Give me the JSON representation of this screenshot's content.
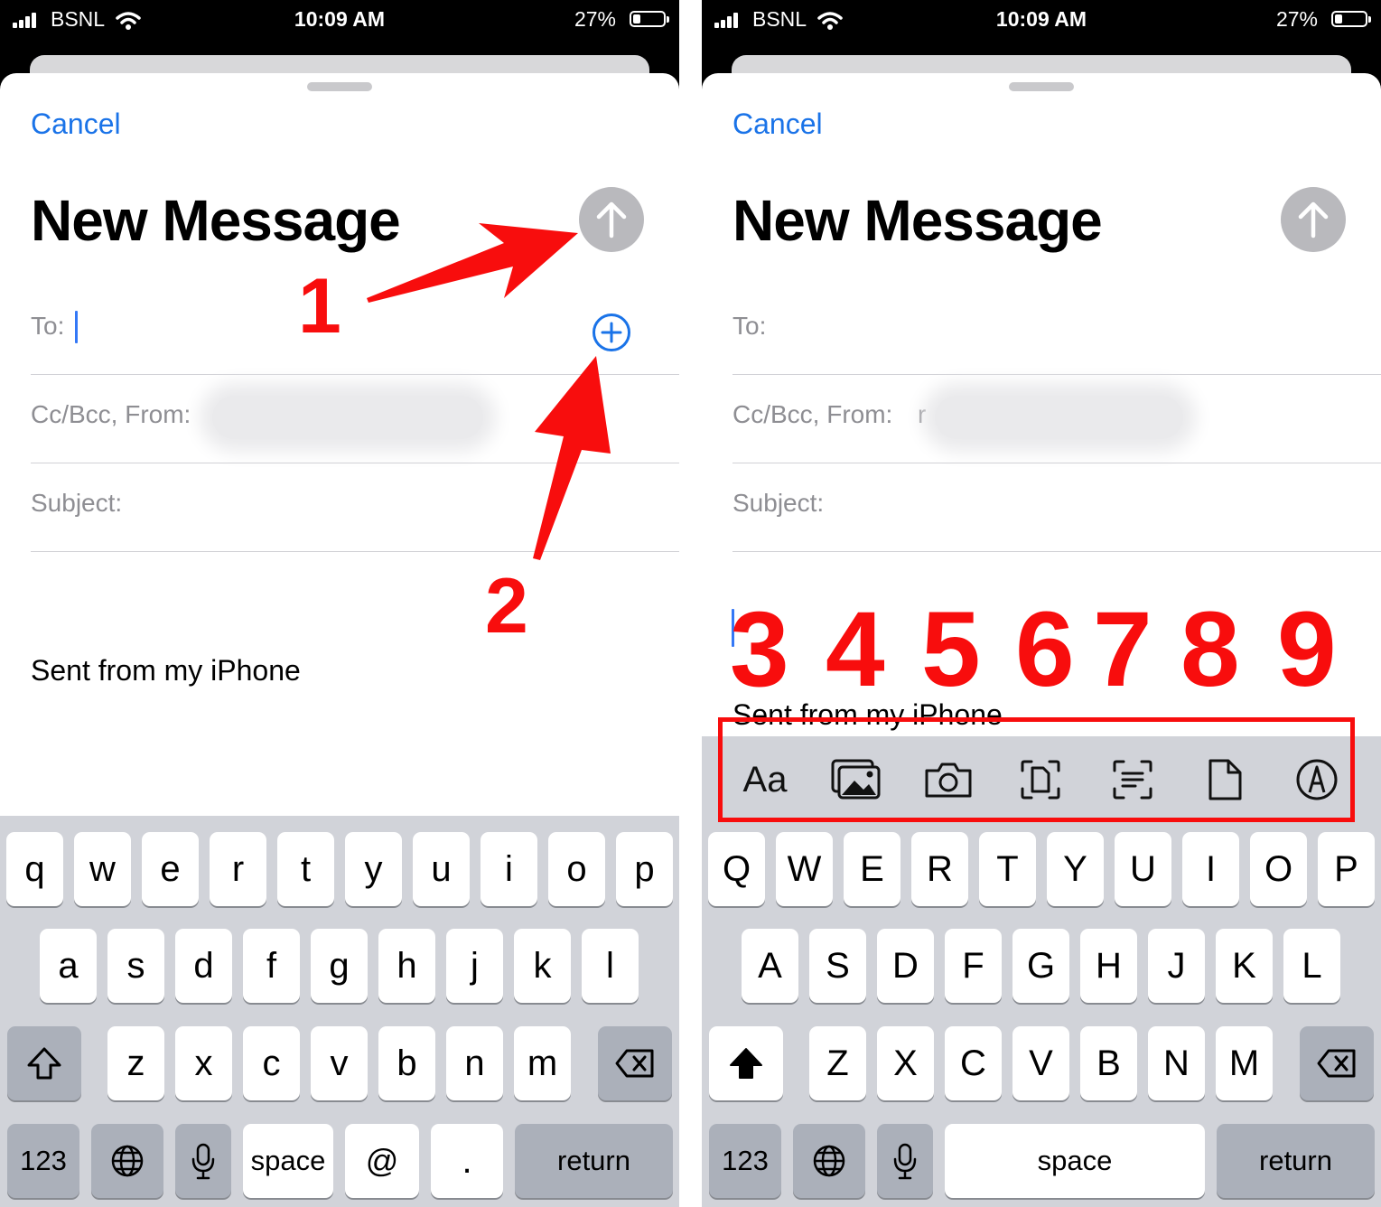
{
  "left_screen": {
    "status_bar": {
      "carrier": "BSNL",
      "time": "10:09 AM",
      "battery_percent": "27%"
    },
    "compose": {
      "cancel_label": "Cancel",
      "title": "New Message",
      "to_label": "To:",
      "cc_from_label": "Cc/Bcc, From:",
      "subject_label": "Subject:",
      "signature": "Sent from my iPhone"
    },
    "keyboard": {
      "row1": [
        "q",
        "w",
        "e",
        "r",
        "t",
        "y",
        "u",
        "i",
        "o",
        "p"
      ],
      "row2": [
        "a",
        "s",
        "d",
        "f",
        "g",
        "h",
        "j",
        "k",
        "l"
      ],
      "row3": [
        "z",
        "x",
        "c",
        "v",
        "b",
        "n",
        "m"
      ],
      "numbers_label": "123",
      "space_label": "space",
      "at_label": "@",
      "period_label": ".",
      "return_label": "return"
    }
  },
  "right_screen": {
    "status_bar": {
      "carrier": "BSNL",
      "time": "10:09 AM",
      "battery_percent": "27%"
    },
    "compose": {
      "cancel_label": "Cancel",
      "title": "New Message",
      "to_label": "To:",
      "cc_from_label": "Cc/Bcc, From:",
      "from_partial": "r",
      "subject_label": "Subject:",
      "signature": "Sent from my iPhone"
    },
    "format_toolbar": {
      "text_format_label": "Aa",
      "tools": [
        "text-format-icon",
        "photo-library-icon",
        "camera-icon",
        "scan-document-icon",
        "scan-text-icon",
        "attach-file-icon",
        "markup-icon"
      ]
    },
    "keyboard": {
      "row1": [
        "Q",
        "W",
        "E",
        "R",
        "T",
        "Y",
        "U",
        "I",
        "O",
        "P"
      ],
      "row2": [
        "A",
        "S",
        "D",
        "F",
        "G",
        "H",
        "J",
        "K",
        "L"
      ],
      "row3": [
        "Z",
        "X",
        "C",
        "V",
        "B",
        "N",
        "M"
      ],
      "numbers_label": "123",
      "space_label": "space",
      "return_label": "return"
    }
  },
  "annotations": {
    "send_marker": "1",
    "add_contact_marker": "2",
    "toolbar_markers": [
      "3",
      "4",
      "5",
      "6",
      "7",
      "8",
      "9"
    ],
    "color": "#f80d0d"
  },
  "colors": {
    "accent": "#1a73e8",
    "send_disabled": "#b9b9bd",
    "keyboard_bg": "#d1d3d9"
  }
}
